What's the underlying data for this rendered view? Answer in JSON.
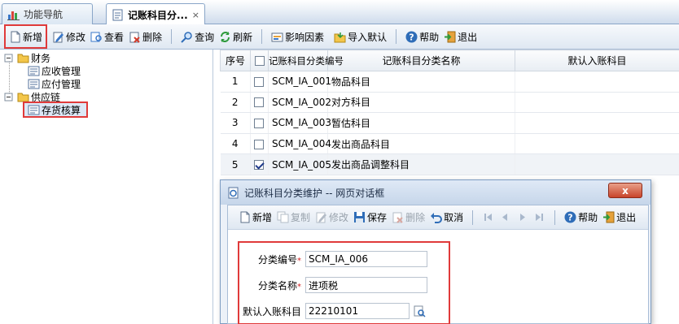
{
  "tabs": [
    {
      "label": "功能导航",
      "icon": "bar-chart-icon"
    },
    {
      "label": "记账科目分...",
      "icon": "document-icon",
      "close": "×"
    }
  ],
  "toolbar": {
    "new": "新增",
    "edit": "修改",
    "view": "查看",
    "delete": "删除",
    "query": "查询",
    "refresh": "刷新",
    "factors": "影响因素",
    "import_default": "导入默认",
    "help": "帮助",
    "exit": "退出"
  },
  "tree": {
    "root1": "财务",
    "ar": "应收管理",
    "ap": "应付管理",
    "root2": "供应链",
    "inventory": "存货核算"
  },
  "grid": {
    "headers": [
      "序号",
      "",
      "记账科目分类编号",
      "记账科目分类名称",
      "默认入账科目"
    ],
    "rows": [
      {
        "no": "1",
        "code": "SCM_IA_001",
        "name": "物品科目",
        "account": "",
        "checked": false
      },
      {
        "no": "2",
        "code": "SCM_IA_002",
        "name": "对方科目",
        "account": "",
        "checked": false
      },
      {
        "no": "3",
        "code": "SCM_IA_003",
        "name": "暂估科目",
        "account": "",
        "checked": false
      },
      {
        "no": "4",
        "code": "SCM_IA_004",
        "name": "发出商品科目",
        "account": "",
        "checked": false
      },
      {
        "no": "5",
        "code": "SCM_IA_005",
        "name": "发出商品调整科目",
        "account": "",
        "checked": true
      }
    ]
  },
  "dialog": {
    "title": "记账科目分类维护 -- 网页对话框",
    "close": "x",
    "toolbar": {
      "new": "新增",
      "copy": "复制",
      "edit": "修改",
      "save": "保存",
      "delete": "删除",
      "cancel": "取消",
      "help": "帮助",
      "exit": "退出"
    },
    "form": {
      "code_label": "分类编号",
      "code_value": "SCM_IA_006",
      "name_label": "分类名称",
      "name_value": "进项税",
      "account_label": "默认入账科目",
      "account_value": "22210101",
      "required_mark": "*"
    }
  }
}
